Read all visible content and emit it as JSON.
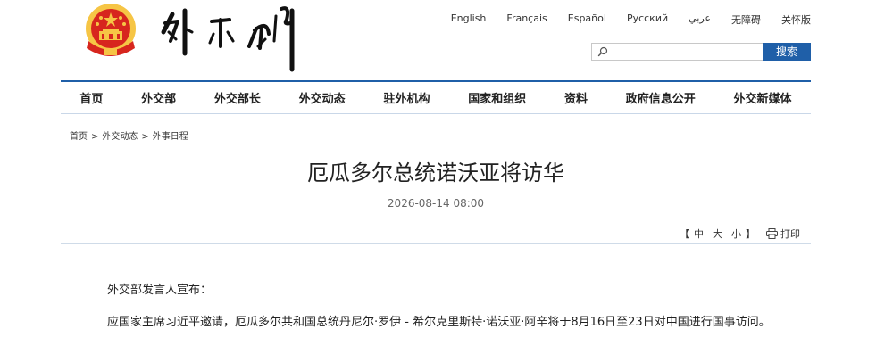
{
  "header": {
    "languages": [
      "English",
      "Français",
      "Español",
      "Русский",
      "عربي",
      "无障碍",
      "关怀版"
    ],
    "search": {
      "placeholder": "",
      "button_label": "搜索"
    }
  },
  "nav": {
    "items": [
      "首页",
      "外交部",
      "外交部长",
      "外交动态",
      "驻外机构",
      "国家和组织",
      "资料",
      "政府信息公开",
      "外交新媒体"
    ]
  },
  "breadcrumb": {
    "items": [
      "首页",
      "外交动态",
      "外事日程"
    ],
    "separator": ">"
  },
  "article": {
    "title": "厄瓜多尔总统诺沃亚将访华",
    "date": "2026-08-14 08:00",
    "font_size": {
      "open": "【",
      "large": "中",
      "medium": "大",
      "small": "小",
      "close": "】"
    },
    "print_label": "打印",
    "paragraphs": [
      "外交部发言人宣布：",
      "应国家主席习近平邀请，厄瓜多尔共和国总统丹尼尔·罗伊 - 希尔克里斯特·诺沃亚·阿辛将于8月16日至23日对中国进行国事访问。"
    ]
  },
  "colors": {
    "accent": "#1f5fa8",
    "emblem_red": "#d7261e",
    "emblem_gold": "#f6c545"
  },
  "icons": {
    "emblem": "national-emblem-icon",
    "search": "search-icon",
    "print": "printer-icon"
  }
}
